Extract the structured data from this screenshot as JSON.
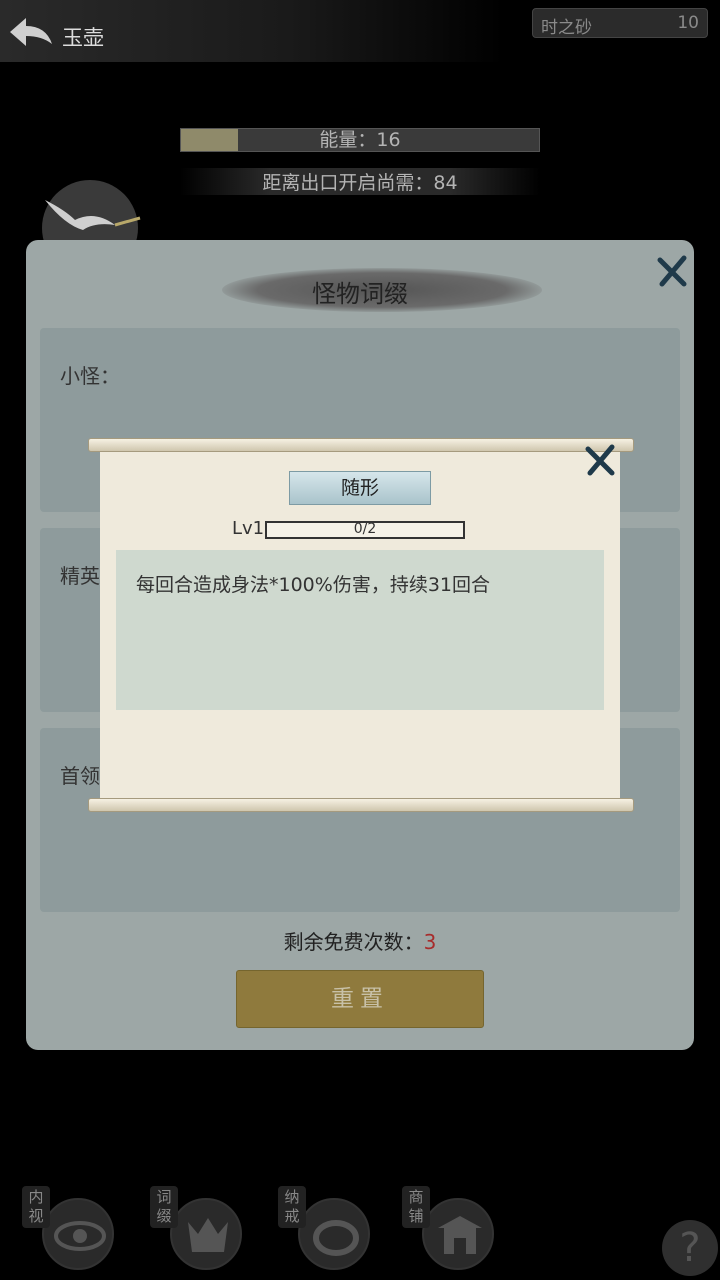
{
  "header": {
    "title": "玉壶",
    "sand_label": "时之砂",
    "sand_value": "10"
  },
  "energy": {
    "text": "能量：16",
    "fraction": 0.16
  },
  "exit": {
    "text": "距离出口开启尚需：84"
  },
  "panel": {
    "title": "怪物词缀",
    "sections": [
      {
        "label": "小怪："
      },
      {
        "label": "精英"
      },
      {
        "label": "首领"
      }
    ],
    "free_label": "剩余免费次数：",
    "free_value": "3",
    "reset_label": "重置"
  },
  "affix": {
    "name": "随形",
    "level": "Lv1",
    "progress_text": "0/2",
    "progress_fraction": 0.0,
    "description": "每回合造成身法*100%伤害，持续31回合"
  },
  "menu": {
    "items": [
      {
        "label": "内视",
        "icon": "eye-icon"
      },
      {
        "label": "词缀",
        "icon": "monster-icon"
      },
      {
        "label": "纳戒",
        "icon": "ring-icon"
      },
      {
        "label": "商铺",
        "icon": "shop-icon"
      }
    ],
    "help": "?"
  },
  "colors": {
    "panel_bg": "#9da7a6",
    "scroll_bg": "#efeadc",
    "reset_button": "#8f7a3d",
    "free_count": "#a72c2c"
  }
}
